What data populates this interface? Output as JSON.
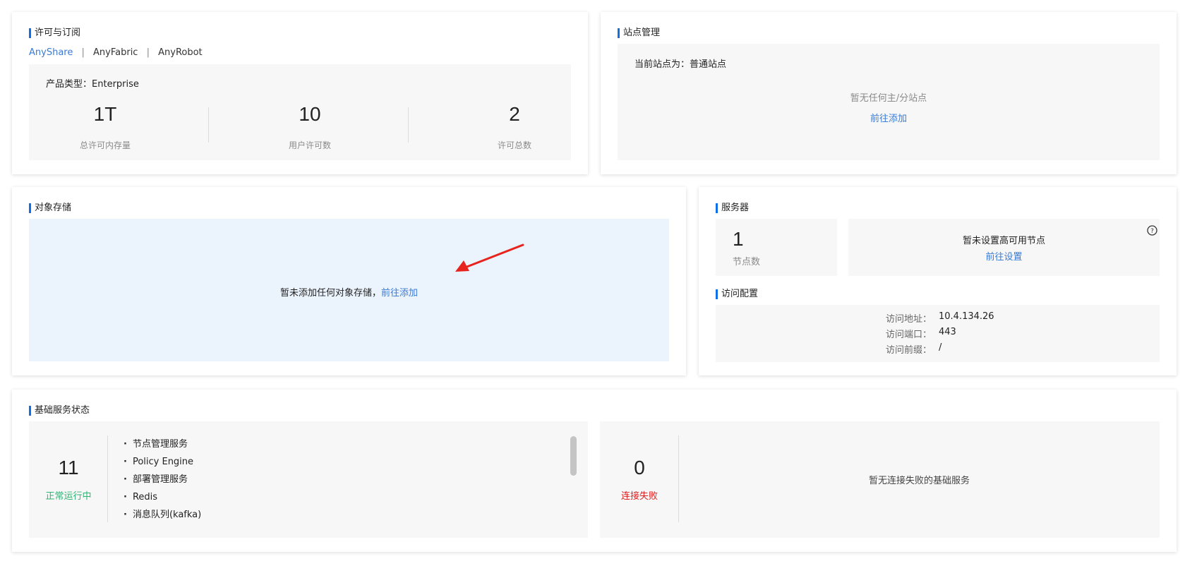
{
  "license": {
    "title": "许可与订阅",
    "tabs": [
      "AnyShare",
      "AnyFabric",
      "AnyRobot"
    ],
    "product_type_label": "产品类型：",
    "product_type_value": "Enterprise",
    "stats": [
      {
        "value": "1T",
        "label": "总许可内存量"
      },
      {
        "value": "10",
        "label": "用户许可数"
      },
      {
        "value": "2",
        "label": "许可总数"
      }
    ]
  },
  "site": {
    "title": "站点管理",
    "current_label": "当前站点为：",
    "current_value": "普通站点",
    "empty_text": "暂无任何主/分站点",
    "add_link": "前往添加"
  },
  "object_storage": {
    "title": "对象存储",
    "empty_text": "暂未添加任何对象存储，",
    "add_link": "前往添加"
  },
  "server": {
    "title": "服务器",
    "node_count": "1",
    "node_label": "节点数",
    "ha_text": "暂未设置高可用节点",
    "ha_link": "前往设置",
    "help_icon": "question-circle-icon"
  },
  "access": {
    "title": "访问配置",
    "rows": [
      {
        "label": "访问地址：",
        "value": "10.4.134.26"
      },
      {
        "label": "访问端口：",
        "value": "443"
      },
      {
        "label": "访问前缀：",
        "value": "/"
      }
    ]
  },
  "basic_services": {
    "title": "基础服务状态",
    "running_count": "11",
    "running_label": "正常运行中",
    "running_color": "#2bb673",
    "services": [
      "节点管理服务",
      "Policy Engine",
      "部署管理服务",
      "Redis",
      "消息队列(kafka)"
    ],
    "failed_count": "0",
    "failed_label": "连接失败",
    "failed_color": "#e02020",
    "failed_empty": "暂无连接失败的基础服务"
  },
  "colors": {
    "accent": "#126ee3",
    "link": "#3a7bd5",
    "storage_bg": "#ebf3fd",
    "arrow": "#e8231e"
  }
}
